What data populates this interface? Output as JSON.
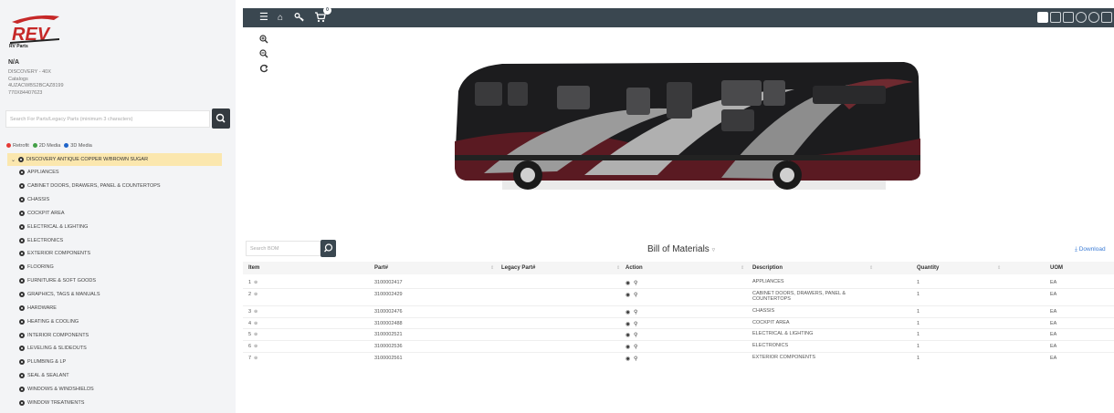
{
  "brand": {
    "logo_text": "REV",
    "subtitle": "RV Parts"
  },
  "unit": {
    "title": "N/A",
    "lines": [
      "DISCOVERY - 40X",
      "Catalogs",
      "4UZACWBS2BCAZ8199",
      "770X84407623"
    ]
  },
  "sidebar_search": {
    "placeholder": "Search For Parts/Legacy Parts (minimum 3 characters)"
  },
  "legend": {
    "items": [
      {
        "label": "Retrofit",
        "color": "#e53935"
      },
      {
        "label": "2D Media",
        "color": "#43a047"
      },
      {
        "label": "3D Media",
        "color": "#1e63c9"
      }
    ]
  },
  "tree": {
    "root": "DISCOVERY ANTIQUE COPPER W/BROWN SUGAR",
    "items": [
      "APPLIANCES",
      "CABINET DOORS, DRAWERS, PANEL & COUNTERTOPS",
      "CHASSIS",
      "COCKPIT AREA",
      "ELECTRICAL & LIGHTING",
      "ELECTRONICS",
      "EXTERIOR COMPONENTS",
      "FLOORING",
      "FURNITURE & SOFT GOODS",
      "GRAPHICS, TAGS & MANUALS",
      "HARDWARE",
      "HEATING & COOLING",
      "INTERIOR COMPONENTS",
      "LEVELING & SLIDEOUTS",
      "PLUMBING & LP",
      "SEAL & SEALANT",
      "WINDOWS & WINDSHIELDS",
      "WINDOW TREATMENTS"
    ]
  },
  "topbar": {
    "icons": [
      "menu-icon",
      "home-icon",
      "key-icon",
      "cart-icon"
    ],
    "cart_count": "0",
    "right_icons": [
      "image-icon",
      "grid-icon",
      "layers-icon",
      "globe-icon",
      "settings-icon",
      "list-icon"
    ]
  },
  "viewer": {
    "zoom_icons": [
      "zoom-in-icon",
      "zoom-out-icon",
      "reset-icon"
    ]
  },
  "bom": {
    "search_placeholder": "Search BOM",
    "title": "Bill of Materials",
    "download_label": "Download",
    "columns": [
      "Item",
      "Part#",
      "Legacy Part#",
      "Action",
      "Description",
      "Quantity",
      "UOM"
    ],
    "rows": [
      {
        "item": "1",
        "part": "3100002417",
        "legacy": "",
        "desc": "APPLIANCES",
        "qty": "1",
        "uom": "EA"
      },
      {
        "item": "2",
        "part": "3100002429",
        "legacy": "",
        "desc": "CABINET DOORS, DRAWERS, PANEL & COUNTERTOPS",
        "qty": "1",
        "uom": "EA"
      },
      {
        "item": "3",
        "part": "3100002476",
        "legacy": "",
        "desc": "CHASSIS",
        "qty": "1",
        "uom": "EA"
      },
      {
        "item": "4",
        "part": "3100002488",
        "legacy": "",
        "desc": "COCKPIT AREA",
        "qty": "1",
        "uom": "EA"
      },
      {
        "item": "5",
        "part": "3100002521",
        "legacy": "",
        "desc": "ELECTRICAL & LIGHTING",
        "qty": "1",
        "uom": "EA"
      },
      {
        "item": "6",
        "part": "3100002536",
        "legacy": "",
        "desc": "ELECTRONICS",
        "qty": "1",
        "uom": "EA"
      },
      {
        "item": "7",
        "part": "3100002561",
        "legacy": "",
        "desc": "EXTERIOR COMPONENTS",
        "qty": "1",
        "uom": "EA"
      }
    ]
  }
}
